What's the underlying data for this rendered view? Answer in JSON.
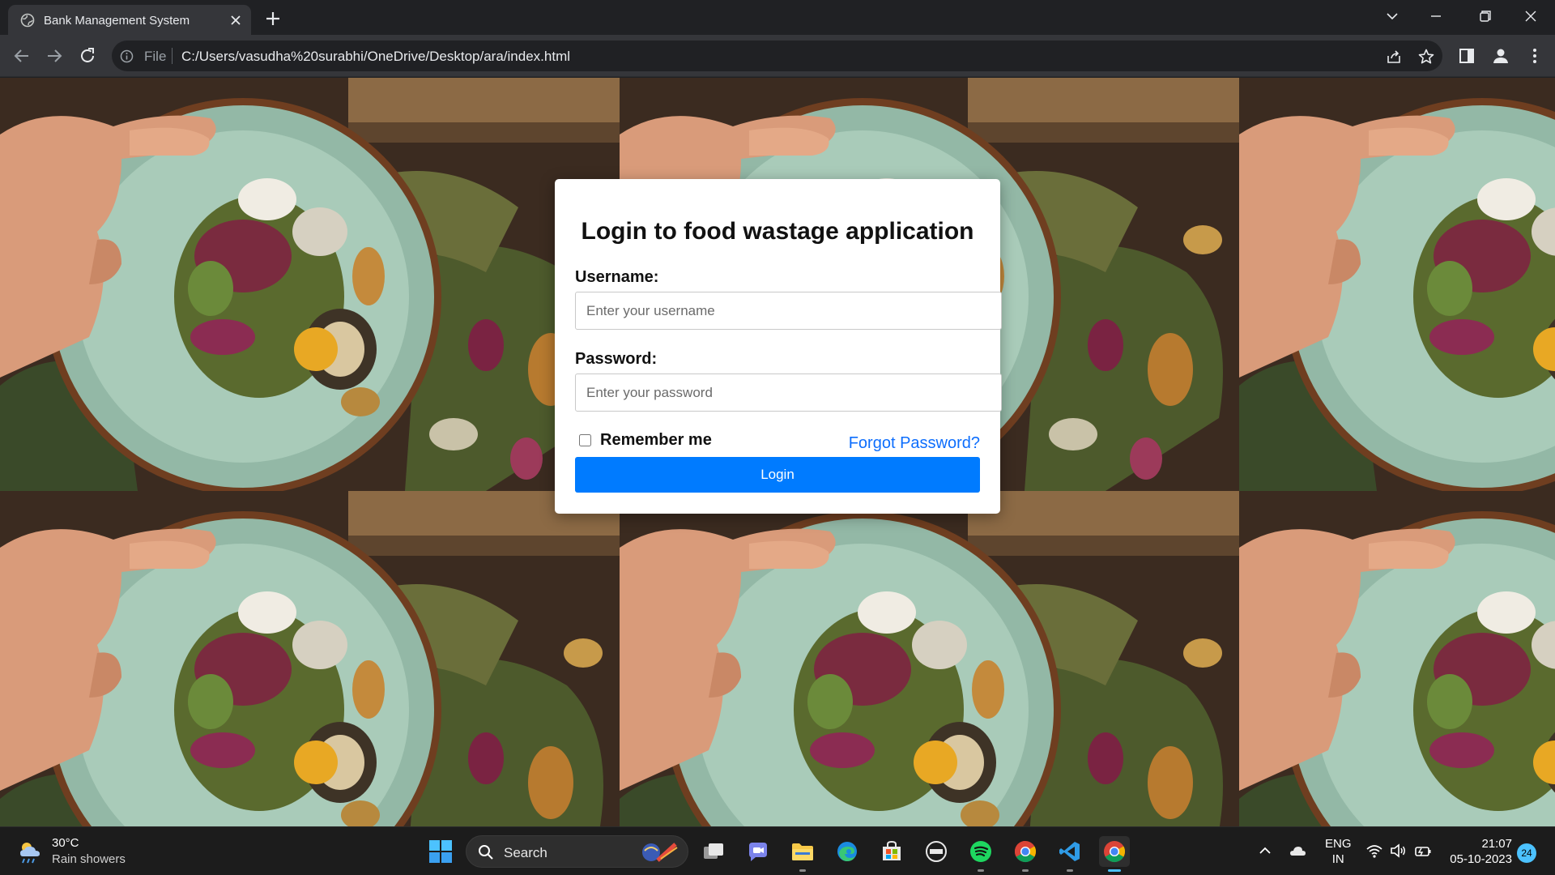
{
  "browser": {
    "tab_title": "Bank Management System",
    "url_scheme": "File",
    "url": "C:/Users/vasudha%20surabhi/OneDrive/Desktop/ara/index.html"
  },
  "login": {
    "title": "Login to food wastage application",
    "username_label": "Username:",
    "username_placeholder": "Enter your username",
    "password_label": "Password:",
    "password_placeholder": "Enter your password",
    "remember_label": "Remember me",
    "forgot_label": "Forgot Password?",
    "login_button": "Login",
    "accent_color": "#007bff"
  },
  "taskbar": {
    "weather_temp": "30°C",
    "weather_desc": "Rain showers",
    "search_label": "Search",
    "lang_line1": "ENG",
    "lang_line2": "IN",
    "time": "21:07",
    "date": "05-10-2023",
    "notification_count": "24"
  }
}
